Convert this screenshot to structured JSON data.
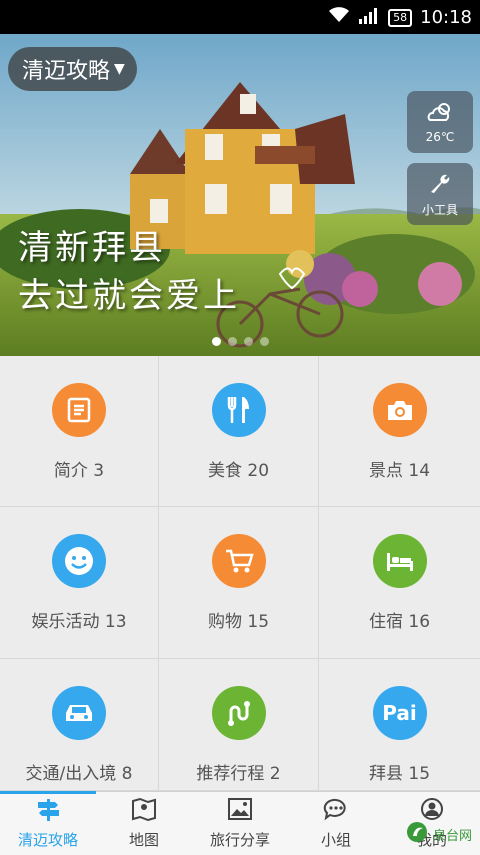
{
  "status": {
    "time": "10:18",
    "battery": "58"
  },
  "header": {
    "title": "清迈攻略"
  },
  "weather": {
    "temp": "26℃"
  },
  "tools": {
    "label": "小工具"
  },
  "banner": {
    "line1": "清新拜县",
    "line2": "去过就会爱上",
    "slide_count": 4,
    "active_slide": 1
  },
  "grid": [
    {
      "label": "简介 3",
      "icon": "document-icon",
      "color": "#f58b35"
    },
    {
      "label": "美食 20",
      "icon": "fork-knife-icon",
      "color": "#36a8ee"
    },
    {
      "label": "景点 14",
      "icon": "camera-icon",
      "color": "#f58b35"
    },
    {
      "label": "娱乐活动 13",
      "icon": "smiley-icon",
      "color": "#36a8ee"
    },
    {
      "label": "购物 15",
      "icon": "shopping-cart-icon",
      "color": "#f58b35"
    },
    {
      "label": "住宿 16",
      "icon": "bed-icon",
      "color": "#6cb433"
    },
    {
      "label": "交通/出入境 8",
      "icon": "car-icon",
      "color": "#36a8ee"
    },
    {
      "label": "推荐行程 2",
      "icon": "route-icon",
      "color": "#6cb433"
    },
    {
      "label": "拜县 15",
      "icon": "pai-icon",
      "icon_text": "Pai",
      "color": "#36a8ee"
    }
  ],
  "tabs": [
    {
      "label": "清迈攻略",
      "icon": "signpost-icon",
      "active": true
    },
    {
      "label": "地图",
      "icon": "map-icon",
      "active": false
    },
    {
      "label": "旅行分享",
      "icon": "picture-icon",
      "active": false
    },
    {
      "label": "小组",
      "icon": "chat-icon",
      "active": false
    },
    {
      "label": "我的",
      "icon": "person-icon",
      "active": false
    }
  ],
  "watermark": {
    "text": "泉台网"
  },
  "colors": {
    "accent": "#29a3ea",
    "orange": "#f58b35",
    "blue": "#36a8ee",
    "green": "#6cb433"
  }
}
